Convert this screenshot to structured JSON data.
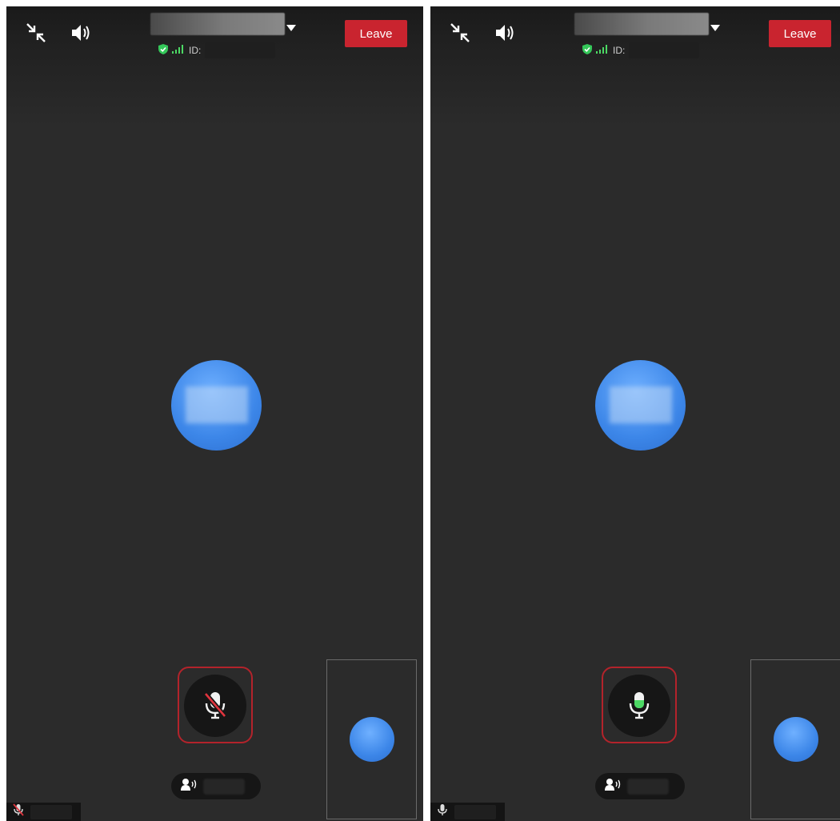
{
  "panels": [
    {
      "id": "before",
      "header": {
        "leave_label": "Leave",
        "id_label": "ID:"
      },
      "mic_state": "muted"
    },
    {
      "id": "after",
      "header": {
        "leave_label": "Leave",
        "id_label": "ID:"
      },
      "mic_state": "unmuted"
    }
  ],
  "icons": {
    "minimize": "minimize-icon",
    "speaker": "speaker-icon",
    "shield": "shield-icon",
    "signal": "signal-icon",
    "dropdown": "chevron-down-icon",
    "mic_muted": "mic-muted-icon",
    "mic_active": "mic-active-icon",
    "speaking": "speaking-participant-icon"
  },
  "colors": {
    "background": "#2b2b2b",
    "leave": "#c9242f",
    "highlight": "#b3232b",
    "avatar": "#3c86e8",
    "shield": "#34c759",
    "mic_active": "#4cd964"
  }
}
